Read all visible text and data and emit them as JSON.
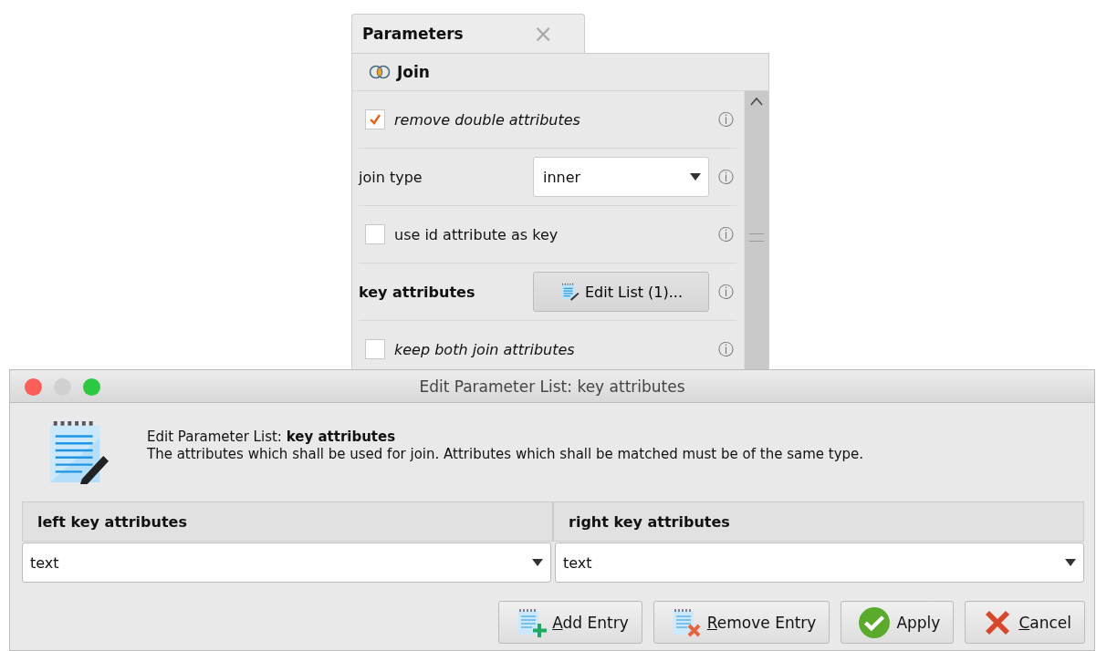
{
  "parameters_panel": {
    "tab": {
      "label": "Parameters",
      "close": "×"
    },
    "operator": {
      "name": "Join"
    },
    "rows": [
      {
        "kind": "checkbox",
        "label": "remove double attributes",
        "expert": true,
        "required": false,
        "checked": true,
        "info": "ⓘ"
      },
      {
        "kind": "select",
        "label": "join type",
        "expert": false,
        "required": false,
        "value": "inner",
        "info": "ⓘ"
      },
      {
        "kind": "checkbox",
        "label": "use id attribute as key",
        "expert": false,
        "required": false,
        "checked": false,
        "info": "ⓘ"
      },
      {
        "kind": "button",
        "label": "key attributes",
        "expert": false,
        "required": true,
        "value": "Edit List (1)...",
        "info": "ⓘ"
      },
      {
        "kind": "checkbox",
        "label": "keep both join attributes",
        "expert": true,
        "required": false,
        "checked": false,
        "info": "ⓘ"
      }
    ]
  },
  "dialog": {
    "title": "Edit Parameter List: key attributes",
    "heading": "Edit Parameter List: **key attributes**",
    "description": "The attributes which shall be used for join. Attributes which shall be matched must be of the same type.",
    "columns": [
      "left key attributes",
      "right key attributes"
    ],
    "rows": [
      [
        "text",
        "text"
      ]
    ],
    "buttons": [
      {
        "kind": "add",
        "underlined": "A",
        "rest": "dd Entry"
      },
      {
        "kind": "remove",
        "underlined": "R",
        "rest": "emove Entry"
      },
      {
        "kind": "apply",
        "rest": "Apply"
      },
      {
        "kind": "cancel",
        "underlined": "C",
        "rest": "ancel"
      }
    ]
  }
}
